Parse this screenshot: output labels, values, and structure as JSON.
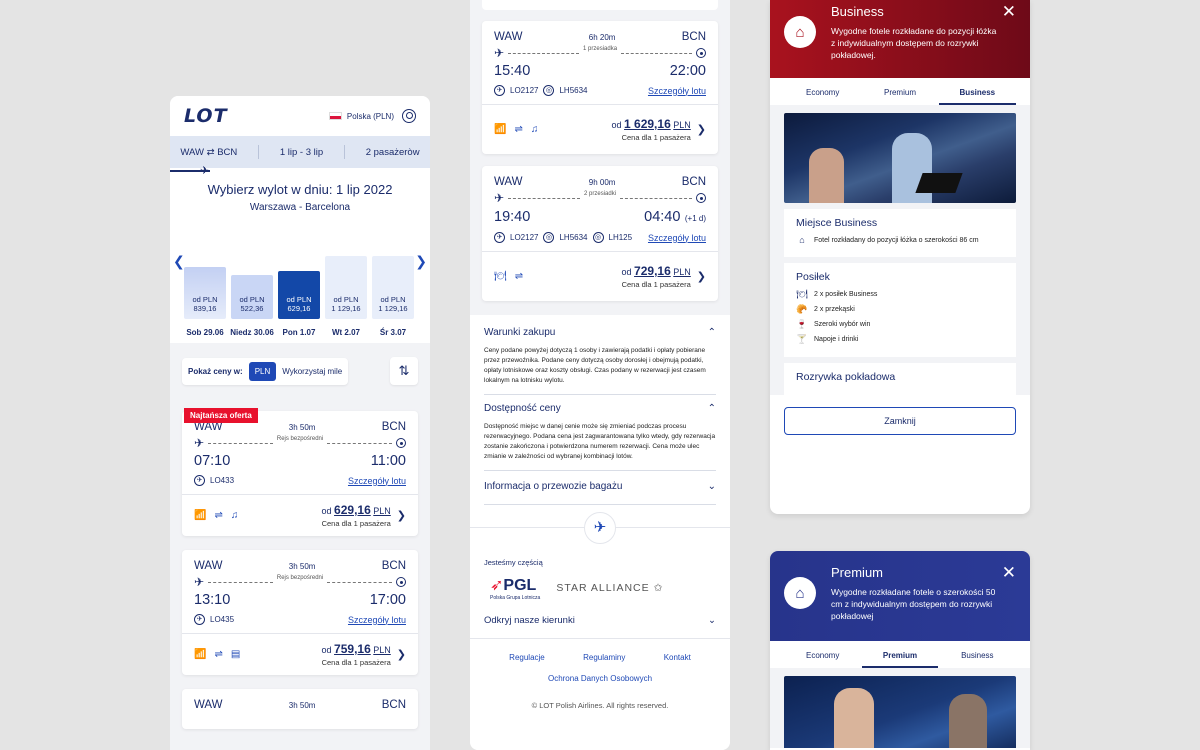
{
  "p1": {
    "logo": "LOT",
    "country": "Polska (PLN)",
    "tabs": [
      "WAW ⇄ BCN",
      "1 lip - 3 lip",
      "2 pasażeròw"
    ],
    "title": "Wybierz wylot w dniu: 1 lip 2022",
    "route": "Warszawa - Barcelona",
    "calendar": [
      {
        "label": "od PLN",
        "price": "839,16",
        "day": "Sob 29.06",
        "level": 0.4,
        "state": "faded"
      },
      {
        "label": "od PLN",
        "price": "522,36",
        "day": "Niedz 30.06",
        "level": 0.21,
        "state": "normal"
      },
      {
        "label": "od PLN",
        "price": "629,16",
        "day": "Pon 1.07",
        "level": 0.31,
        "state": "selected"
      },
      {
        "label": "od PLN",
        "price": "1 129,16",
        "day": "Wt 2.07",
        "level": 0.62,
        "state": "light"
      },
      {
        "label": "od PLN",
        "price": "1 129,16",
        "day": "Śr 3.07",
        "level": 0.62,
        "state": "light"
      }
    ],
    "show_prices_label": "Pokaż ceny w:",
    "currency_on": "PLN",
    "currency_off": "Wykorzystaj mile",
    "badge": "Najtańsza oferta",
    "flights": [
      {
        "from": "WAW",
        "to": "BCN",
        "duration": "3h 50m",
        "stops": "Rejs bezpośredni",
        "dep": "07:10",
        "arr": "11:00",
        "nums": "LO433",
        "details": "Szczegóły lotu",
        "price_prefix": "od",
        "price": "629,16",
        "currency": "PLN",
        "per": "Cena dla 1 pasażera"
      },
      {
        "from": "WAW",
        "to": "BCN",
        "duration": "3h 50m",
        "stops": "Rejs bezpośredni",
        "dep": "13:10",
        "arr": "17:00",
        "nums": "LO435",
        "details": "Szczegóły lotu",
        "price_prefix": "od",
        "price": "759,16",
        "currency": "PLN",
        "per": "Cena dla 1 pasażera"
      },
      {
        "from": "WAW",
        "to": "BCN",
        "duration": "3h 50m"
      }
    ]
  },
  "p2": {
    "flights": [
      {
        "from": "WAW",
        "to": "BCN",
        "duration": "6h 20m",
        "stops": "1 przesiadka",
        "dep": "15:40",
        "arr": "22:00",
        "arr_extra": "",
        "n1": "LO2127",
        "n2": "LH5634",
        "n3": "",
        "details": "Szczegóły lotu",
        "price_prefix": "od",
        "price": "1 629,16",
        "currency": "PLN",
        "per": "Cena dla 1 pasażera"
      },
      {
        "from": "WAW",
        "to": "BCN",
        "duration": "9h 00m",
        "stops": "2 przesiadki",
        "dep": "19:40",
        "arr": "04:40",
        "arr_extra": "(+1 d)",
        "n1": "LO2127",
        "n2": "LH5634",
        "n3": "LH125",
        "details": "Szczegóły lotu",
        "price_prefix": "od",
        "price": "729,16",
        "currency": "PLN",
        "per": "Cena dla 1 pasażera"
      }
    ],
    "conditions": [
      {
        "title": "Warunki zakupu",
        "text": "Ceny podane powyżej dotyczą 1 osoby i zawierają podatki i opłaty pobierane przez przewoźnika. Podane ceny dotyczą osoby dorosłej i obejmują podatki, opłaty lotniskowe oraz koszty obsługi. Czas podany w rezerwacji jest czasem lokalnym na lotnisku wylotu."
      },
      {
        "title": "Dostępność ceny",
        "text": "Dostępność miejsc w danej cenie może się zmieniać podczas procesu rezerwacyjnego. Podana cena jest zagwarantowana tylko wtedy, gdy rezerwacja zostanie zakończona i potwierdzona numerem rezerwacji. Cena może ulec zmianie w zależności od wybranej kombinacji lotów."
      },
      {
        "title": "Informacja o przewozie bagażu",
        "text": ""
      }
    ],
    "part_of": "Jesteśmy częścią",
    "pgl": "PGL",
    "pgl_sub": "Polska Grupa Lotnicza",
    "star": "STAR ALLIANCE",
    "discover": "Odkryj nasze kierunki",
    "footer_links": [
      "Regulacje",
      "Regulaminy",
      "Kontakt"
    ],
    "privacy": "Ochrona Danych Osobowych",
    "copyright": "© LOT Polish Airlines. All rights reserved."
  },
  "business": {
    "title": "Business",
    "desc": "Wygodne fotele rozkładane do pozycji łóżka z indywidualnym dostępem do rozrywki pokładowej.",
    "tabs": [
      "Economy",
      "Premium",
      "Business"
    ],
    "active": 2,
    "seat_title": "Miejsce Business",
    "seat_text": "Fotel rozkładany do pozycji łóżka o szerokości 86 cm",
    "meal_title": "Posiłek",
    "meals": [
      "2 x posiłek Business",
      "2 x przekąski",
      "Szeroki wybór win",
      "Napoje i drinki"
    ],
    "ent_title": "Rozrywka pokładowa",
    "close": "Zamknij"
  },
  "premium": {
    "title": "Premium",
    "desc": "Wygodne rozkładane fotele o szerokości 50 cm z indywidualnym dostępem do rozrywki pokładowej",
    "tabs": [
      "Economy",
      "Premium",
      "Business"
    ],
    "active": 1
  }
}
